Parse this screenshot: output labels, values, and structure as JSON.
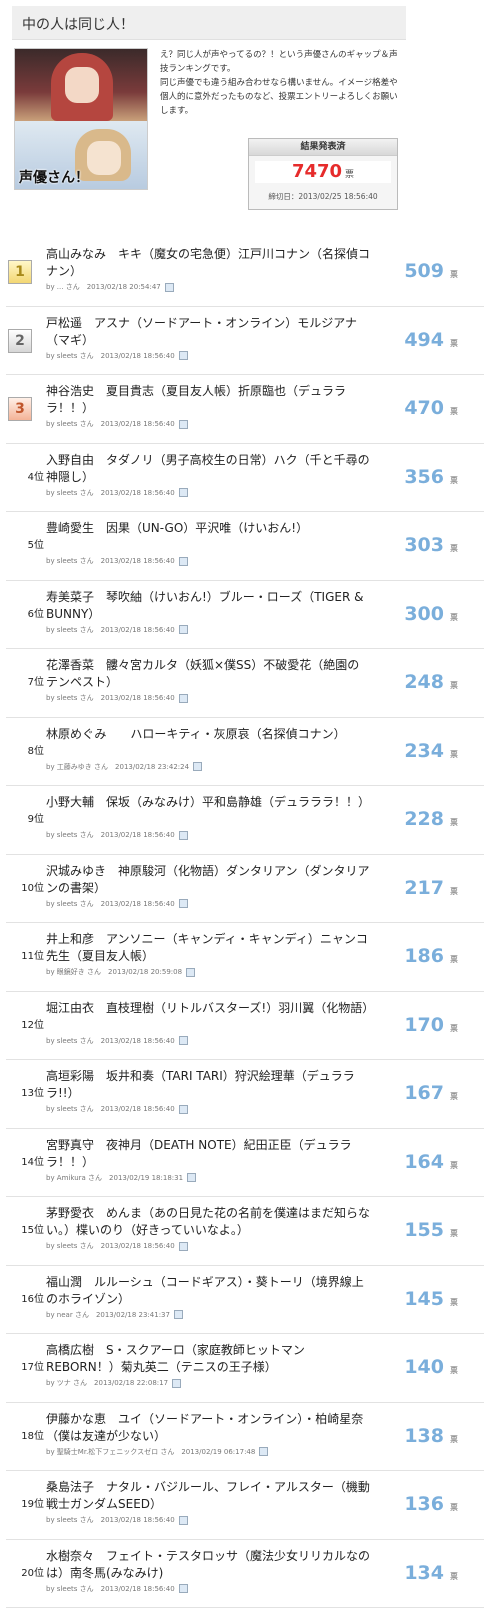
{
  "header": {
    "title": "中の人は同じ人！"
  },
  "thumbnail": {
    "label": "声優さん！"
  },
  "description": [
    "え？同じ人が声やってるの？！という声優さんのギャップ＆声技ランキングです。",
    "同じ声優でも違う組み合わせなら構いません。イメージ格差や個人的に意外だったものなど、投票エントリーよろしくお願いします。"
  ],
  "result": {
    "heading": "結果発表済",
    "total_votes": "7470",
    "vote_unit": "票",
    "deadline": "締切日：2013/02/25 18:56:40"
  },
  "rankings": [
    {
      "rank": "1",
      "title": "高山みなみ　キキ（魔女の宅急便）江戸川コナン（名探偵コナン）",
      "meta": "by ... さん　2013/02/18 20:54:47",
      "votes": "509",
      "unit": "票"
    },
    {
      "rank": "2",
      "title": "戸松遥　アスナ（ソードアート・オンライン）モルジアナ（マギ）",
      "meta": "by sleets さん　2013/02/18 18:56:40",
      "votes": "494",
      "unit": "票"
    },
    {
      "rank": "3",
      "title": "神谷浩史　夏目貴志（夏目友人帳）折原臨也（デュラララ！！）",
      "meta": "by sleets さん　2013/02/18 18:56:40",
      "votes": "470",
      "unit": "票"
    },
    {
      "rank": "4位",
      "title": "入野自由　タダノリ（男子高校生の日常）ハク（千と千尋の神隠し）",
      "meta": "by sleets さん　2013/02/18 18:56:40",
      "votes": "356",
      "unit": "票"
    },
    {
      "rank": "5位",
      "title": "豊崎愛生　因果（UN-GO）平沢唯（けいおん!）",
      "meta": "by sleets さん　2013/02/18 18:56:40",
      "votes": "303",
      "unit": "票"
    },
    {
      "rank": "6位",
      "title": "寿美菜子　琴吹紬（けいおん!）ブルー・ローズ（TIGER & BUNNY）",
      "meta": "by sleets さん　2013/02/18 18:56:40",
      "votes": "300",
      "unit": "票"
    },
    {
      "rank": "7位",
      "title": "花澤香菜　髏々宮カルタ（妖狐×僕SS）不破愛花（絶園のテンペスト）",
      "meta": "by sleets さん　2013/02/18 18:56:40",
      "votes": "248",
      "unit": "票"
    },
    {
      "rank": "8位",
      "title": "林原めぐみ　　ハローキティ・灰原哀（名探偵コナン）",
      "meta": "by 工藤みゆき さん　2013/02/18 23:42:24",
      "votes": "234",
      "unit": "票"
    },
    {
      "rank": "9位",
      "title": "小野大輔　保坂（みなみけ）平和島静雄（デュラララ！！）",
      "meta": "by sleets さん　2013/02/18 18:56:40",
      "votes": "228",
      "unit": "票"
    },
    {
      "rank": "10位",
      "title": "沢城みゆき　神原駿河（化物語）ダンタリアン（ダンタリアンの書架）",
      "meta": "by sleets さん　2013/02/18 18:56:40",
      "votes": "217",
      "unit": "票"
    },
    {
      "rank": "11位",
      "title": "井上和彦　アンソニー（キャンディ・キャンディ）ニャンコ先生（夏目友人帳）",
      "meta": "by 眼鏡好き さん　2013/02/18 20:59:08",
      "votes": "186",
      "unit": "票"
    },
    {
      "rank": "12位",
      "title": "堀江由衣　直枝理樹（リトルバスターズ!）羽川翼（化物語）",
      "meta": "by sleets さん　2013/02/18 18:56:40",
      "votes": "170",
      "unit": "票"
    },
    {
      "rank": "13位",
      "title": "高垣彩陽　坂井和奏（TARI TARI）狩沢絵理華（デュラララ!!）",
      "meta": "by sleets さん　2013/02/18 18:56:40",
      "votes": "167",
      "unit": "票"
    },
    {
      "rank": "14位",
      "title": "宮野真守　夜神月（DEATH NOTE）紀田正臣（デュラララ！！）",
      "meta": "by Amikura さん　2013/02/19 18:18:31",
      "votes": "164",
      "unit": "票"
    },
    {
      "rank": "15位",
      "title": "茅野愛衣　めんま（あの日見た花の名前を僕達はまだ知らない。）楪いのり（好きっていいなよ。）",
      "meta": "by sleets さん　2013/02/18 18:56:40",
      "votes": "155",
      "unit": "票"
    },
    {
      "rank": "16位",
      "title": "福山潤　ルルーシュ（コードギアス）・葵トーリ（境界線上のホライゾン）",
      "meta": "by near さん　2013/02/18 23:41:37",
      "votes": "145",
      "unit": "票"
    },
    {
      "rank": "17位",
      "title": "高橋広樹　S・スクアーロ（家庭教師ヒットマンREBORN！）菊丸英二（テニスの王子様）",
      "meta": "by ツナ さん　2013/02/18 22:08:17",
      "votes": "140",
      "unit": "票"
    },
    {
      "rank": "18位",
      "title": "伊藤かな恵　ユイ（ソードアート・オンライン）・柏崎星奈（僕は友達が少ない）",
      "meta": "by 聖騎士Mr.松下フェニックスゼロ さん　2013/02/19 06:17:48",
      "votes": "138",
      "unit": "票"
    },
    {
      "rank": "19位",
      "title": "桑島法子　ナタル・バジルール、フレイ・アルスター（機動戦士ガンダムSEED）",
      "meta": "by sleets さん　2013/02/18 18:56:40",
      "votes": "136",
      "unit": "票"
    },
    {
      "rank": "20位",
      "title": "水樹奈々　フェイト・テスタロッサ（魔法少女リリカルなのは）南冬馬(みなみけ)",
      "meta": "by sleets さん　2013/02/18 18:56:40",
      "votes": "134",
      "unit": "票"
    }
  ]
}
